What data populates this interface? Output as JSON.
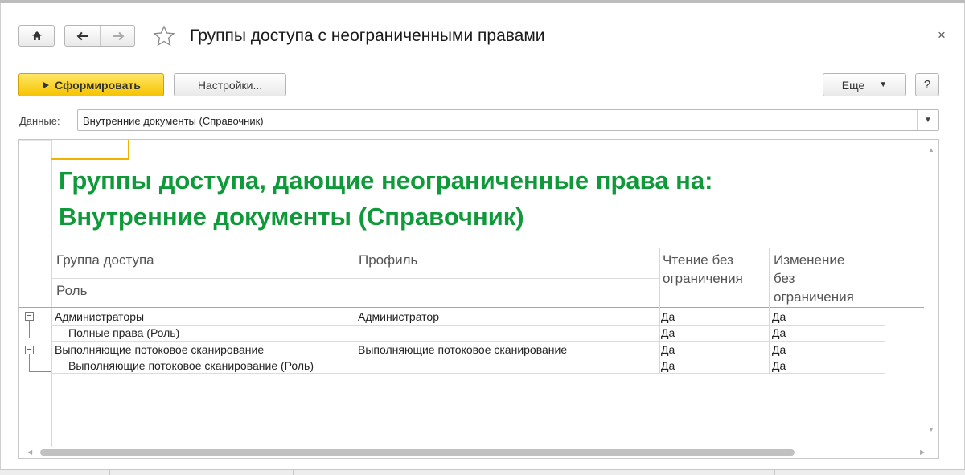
{
  "window": {
    "title": "Группы доступа с неограниченными правами",
    "close_icon": "×"
  },
  "toolbar": {
    "home_icon": "home-icon",
    "back_icon": "back-arrow-icon",
    "forward_icon": "forward-arrow-icon",
    "favorite_icon": "star-icon",
    "generate_label": "Сформировать",
    "settings_label": "Настройки...",
    "more_label": "Еще",
    "help_label": "?"
  },
  "filter": {
    "label": "Данные:",
    "value": "Внутренние документы (Справочник)"
  },
  "report": {
    "title_line1": "Группы доступа, дающие неограниченные права на:",
    "title_line2": "Внутренние документы (Справочник)",
    "title_color": "#0f9a3a",
    "headers": {
      "group": "Группа доступа",
      "role": "Роль",
      "profile": "Профиль",
      "read_line1": "Чтение без",
      "read_line2": "ограничения",
      "change_line1": "Изменение",
      "change_line2": "без",
      "change_line3": "ограничения"
    },
    "rows": [
      {
        "name": "Администраторы",
        "profile": "Администратор",
        "read": "Да",
        "change": "Да"
      },
      {
        "name": "Полные права (Роль)",
        "profile": "",
        "read": "Да",
        "change": "Да"
      },
      {
        "name": "Выполняющие потоковое сканирование",
        "profile": "Выполняющие потоковое сканирование",
        "read": "Да",
        "change": "Да"
      },
      {
        "name": "Выполняющие потоковое сканирование (Роль)",
        "profile": "",
        "read": "Да",
        "change": "Да"
      }
    ]
  },
  "colors": {
    "accent_button": "#f5c400",
    "cursor_border": "#f0b400"
  }
}
